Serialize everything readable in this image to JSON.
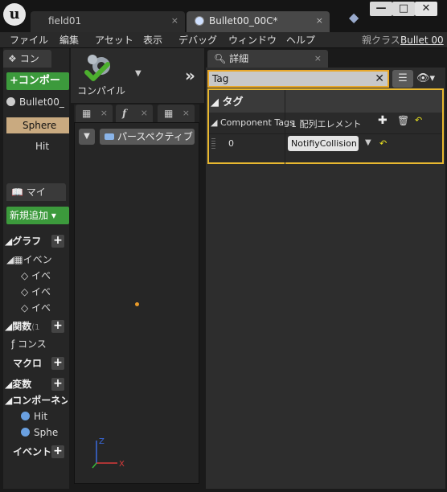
{
  "titlebar": {
    "logo_text": "u",
    "tabs": [
      {
        "label": "field01",
        "close": "×"
      },
      {
        "label": "Bullet00_00C*",
        "close": "×"
      }
    ],
    "window_buttons": {
      "minimize": "—",
      "maximize": "□",
      "close": "✕"
    }
  },
  "menu": {
    "items": [
      "ファイル",
      "編集",
      "アセット",
      "表示",
      "デバッグ",
      "ウィンドウ",
      "ヘルプ"
    ],
    "parent_class_label": "親クラス",
    "parent_class_value": "Bullet 00"
  },
  "components": {
    "tab_label": "コン",
    "add_button": "+コンポー",
    "tree": {
      "self": "Bullet00_",
      "sphere": "Sphere",
      "hit": "Hit"
    }
  },
  "mybp": {
    "tab_label": "マイ",
    "add_new": "新規追加",
    "sections": {
      "graph": "グラフ",
      "events": "イベン",
      "event_items": [
        "イベ",
        "イベ",
        "イベ"
      ],
      "functions": "関数",
      "functions_count": "(1",
      "construction": "コンス",
      "macros": "マクロ",
      "variables": "変数",
      "components": "コンポーネン",
      "var_items": [
        "Hit",
        "Sphe"
      ],
      "dispatchers": "イベント"
    },
    "plus": "+"
  },
  "toolbar": {
    "compile_label": "コンパイル",
    "dropdown": "▼",
    "expand": "»"
  },
  "viewport": {
    "tab_close": "×",
    "function_tab_icon": "f",
    "view_dropdown": "▼",
    "perspective_label": "パースペクティブ",
    "axis": {
      "z": "Z",
      "x": "X"
    }
  },
  "details": {
    "tab_label": "詳細",
    "search_value": "Tag",
    "search_clear": "✕",
    "category": "タグ",
    "component_tags_label": "Component Tags",
    "array_count": "1 配列エレメント",
    "element_index": "0",
    "element_value": "NotifiyCollision"
  },
  "colors": {
    "accent_green": "#3c9a3c",
    "highlight_orange": "#e8a82a",
    "selected_component": "#c9aa80"
  }
}
